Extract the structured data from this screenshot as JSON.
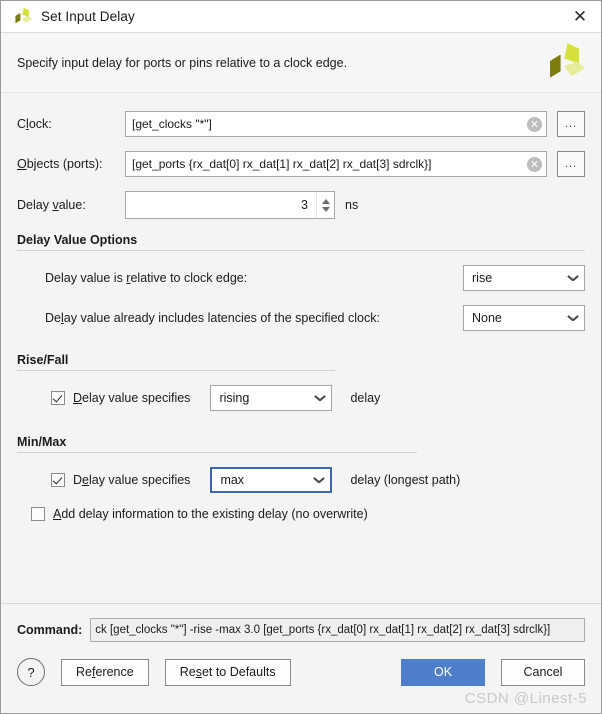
{
  "window": {
    "title": "Set Input Delay",
    "icon": "vivado-logo-icon",
    "close_label": "✕"
  },
  "header": {
    "description": "Specify input delay for ports or pins relative to a clock edge.",
    "logo": "vivado-logo-icon"
  },
  "form": {
    "clock": {
      "label_prefix": "C",
      "label_accel": "l",
      "label_suffix": "ock:",
      "value": "[get_clocks  \"*\"]",
      "clear_icon": "✕",
      "browse_label": "..."
    },
    "objects": {
      "label_prefix": "",
      "label_accel": "O",
      "label_suffix": "bjects (ports):",
      "value": "[get_ports {rx_dat[0] rx_dat[1] rx_dat[2] rx_dat[3] sdrclk}]",
      "clear_icon": "✕",
      "browse_label": "..."
    },
    "delay_value": {
      "label_prefix": "Delay ",
      "label_accel": "v",
      "label_suffix": "alue:",
      "value": "3",
      "unit": "ns"
    }
  },
  "delay_value_options": {
    "title": "Delay Value Options",
    "relative": {
      "label_prefix": "Delay value is ",
      "label_accel": "r",
      "label_suffix": "elative to clock edge:",
      "value": "rise"
    },
    "latencies": {
      "label_prefix": "De",
      "label_accel": "l",
      "label_suffix": "ay value already includes latencies of the specified clock:",
      "value": "None"
    }
  },
  "rise_fall": {
    "title": "Rise/Fall",
    "checkbox_checked": true,
    "label_prefix": "",
    "label_accel": "D",
    "label_suffix": "elay value specifies",
    "value": "rising",
    "suffix_text": "delay"
  },
  "min_max": {
    "title": "Min/Max",
    "checkbox_checked": true,
    "label_prefix": "D",
    "label_accel": "e",
    "label_suffix": "lay value specifies",
    "value": "max",
    "suffix_text": "delay (longest path)",
    "add_delay": {
      "checked": false,
      "label_prefix": "",
      "label_accel": "A",
      "label_suffix": "dd delay information to the existing delay (no overwrite)"
    }
  },
  "footer": {
    "command_label": "Command:",
    "command_value": "ck [get_clocks  \"*\"] -rise -max 3.0 [get_ports {rx_dat[0] rx_dat[1] rx_dat[2] rx_dat[3] sdrclk}]",
    "help_label": "?",
    "reference": {
      "prefix": "Re",
      "accel": "f",
      "suffix": "erence"
    },
    "reset": {
      "prefix": "Re",
      "accel": "s",
      "suffix": "et to Defaults"
    },
    "ok_label": "OK",
    "cancel_label": "Cancel"
  },
  "watermark": "CSDN @Linest-5",
  "colors": {
    "accent_blue": "#4f7fcb",
    "focus_blue": "#3c66b0",
    "logo_bright": "#d6e03a",
    "logo_dark": "#7d7d0b",
    "logo_pale": "#e7ec9a"
  }
}
